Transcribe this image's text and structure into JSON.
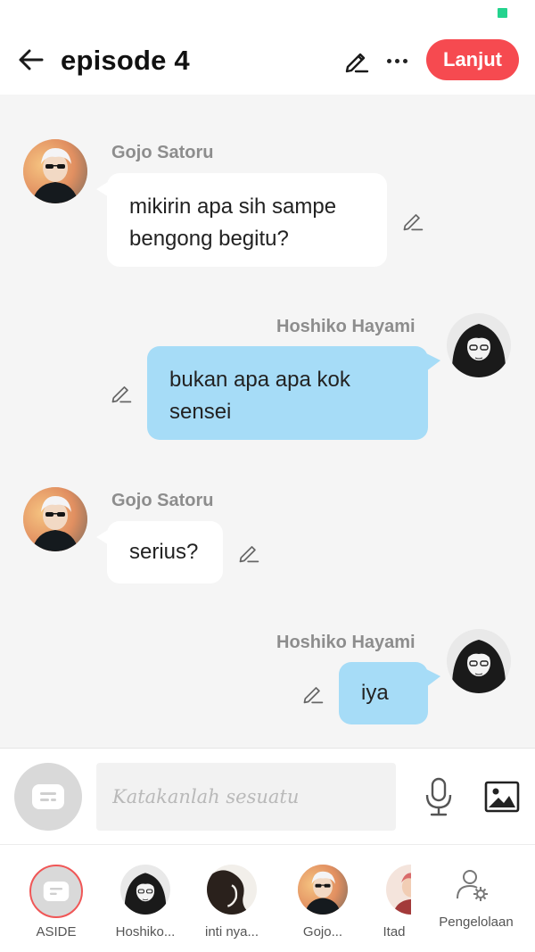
{
  "header": {
    "title": "episode 4",
    "next_label": "Lanjut"
  },
  "messages": [
    {
      "sender": "Gojo Satoru",
      "side": "left",
      "text_lines": [
        "mikirin apa sih sampe",
        "bengong begitu?"
      ]
    },
    {
      "sender": "Hoshiko Hayami",
      "side": "right",
      "text_lines": [
        "bukan apa apa kok",
        "sensei"
      ]
    },
    {
      "sender": "Gojo Satoru",
      "side": "left",
      "text_lines": [
        "serius?"
      ]
    },
    {
      "sender": "Hoshiko Hayami",
      "side": "right",
      "text_lines": [
        "iya"
      ]
    }
  ],
  "input": {
    "placeholder": "Katakanlah sesuatu"
  },
  "characters": [
    {
      "label": "ASIDE"
    },
    {
      "label": "Hoshiko..."
    },
    {
      "label": "inti nya..."
    },
    {
      "label": "Gojo..."
    },
    {
      "label": "Itad"
    },
    {
      "label": "Pengelolaan"
    }
  ],
  "colors": {
    "accent": "#f64a50",
    "bubble_right": "#a6dcf7",
    "bubble_left": "#ffffff",
    "status_dot": "#24d38e",
    "aside_ring": "#f05656"
  },
  "icons": [
    "back-arrow-icon",
    "pencil-icon",
    "more-icon",
    "microphone-icon",
    "image-icon",
    "aside-chat-icon",
    "user-gear-icon"
  ]
}
